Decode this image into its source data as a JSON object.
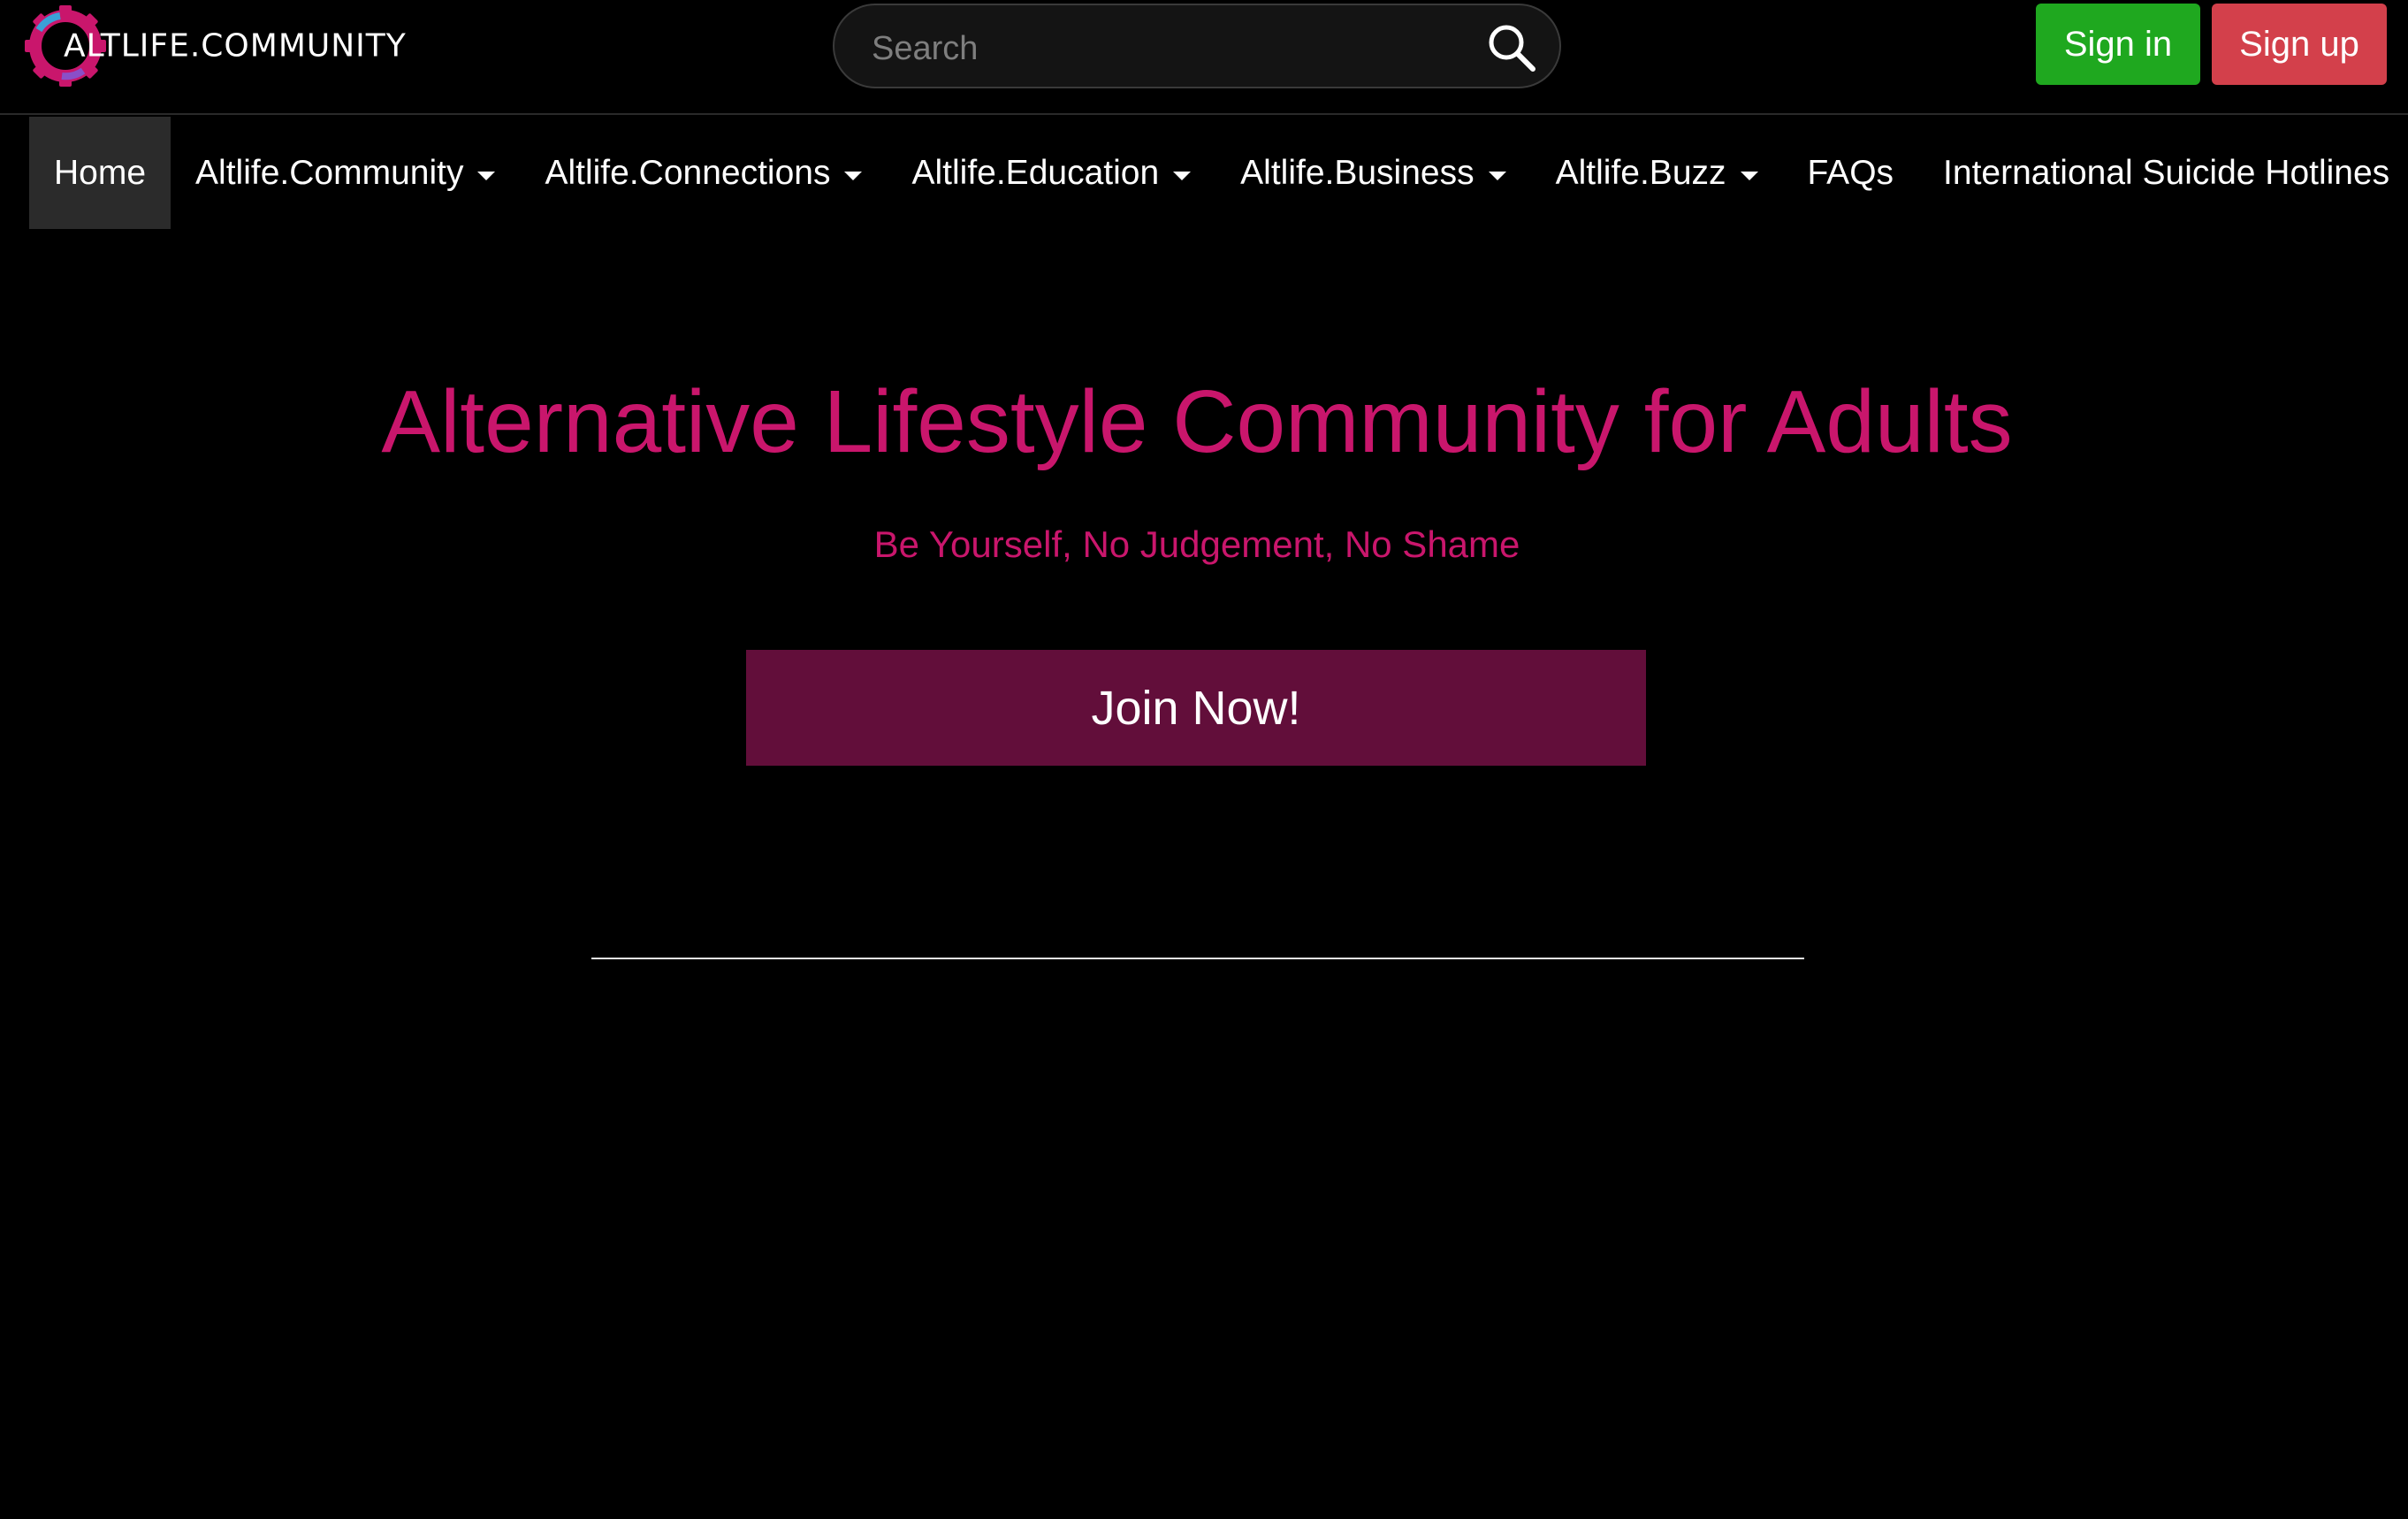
{
  "header": {
    "logo_text": "ALTLIFE.COMMUNITY",
    "search_placeholder": "Search",
    "sign_in_label": "Sign in",
    "sign_up_label": "Sign up"
  },
  "nav": {
    "items": [
      {
        "label": "Home",
        "has_dropdown": false,
        "active": true
      },
      {
        "label": "Altlife.Community",
        "has_dropdown": true
      },
      {
        "label": "Altlife.Connections",
        "has_dropdown": true
      },
      {
        "label": "Altlife.Education",
        "has_dropdown": true
      },
      {
        "label": "Altlife.Business",
        "has_dropdown": true
      },
      {
        "label": "Altlife.Buzz",
        "has_dropdown": true
      },
      {
        "label": "FAQs",
        "has_dropdown": false
      },
      {
        "label": "International Suicide Hotlines",
        "has_dropdown": false
      }
    ]
  },
  "hero": {
    "title": "Alternative Lifestyle Community for Adults",
    "subtitle": "Be Yourself, No Judgement, No Shame",
    "join_label": "Join Now!"
  },
  "colors": {
    "accent": "#c9166c",
    "join_button": "#620e3a",
    "sign_in": "#1fa81f",
    "sign_up": "#d3404b",
    "background": "#000000"
  },
  "icons": {
    "search": "search-icon",
    "logo": "gear-logo-icon",
    "dropdown": "caret-down-icon"
  }
}
